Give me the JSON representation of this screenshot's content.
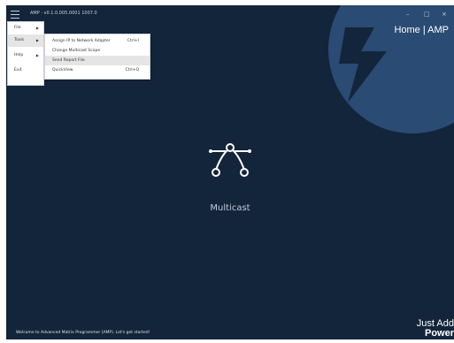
{
  "titlebar": {
    "app_title": "AMP · v0.1.0.005.0001 1007.0",
    "minimize_glyph": "–",
    "maximize_glyph": "□",
    "close_glyph": "×"
  },
  "header": {
    "home_link": "Home | AMP"
  },
  "menu": {
    "items": [
      {
        "label": "File",
        "has_submenu": true
      },
      {
        "label": "Tools",
        "has_submenu": true
      },
      {
        "label": "Help",
        "has_submenu": true
      },
      {
        "label": "Exit",
        "has_submenu": false
      }
    ],
    "active_item": "Tools"
  },
  "tools_submenu": {
    "items": [
      {
        "label": "Assign IP to Network Adapter",
        "shortcut": "Ctrl+I"
      },
      {
        "label": "Change Multicast Scope",
        "shortcut": ""
      },
      {
        "label": "Send Report File",
        "shortcut": ""
      },
      {
        "label": "QuickView",
        "shortcut": "Ctrl+Q"
      }
    ],
    "hovered_item": "Send Report File"
  },
  "main": {
    "icon": "multicast-icon",
    "label": "Multicast"
  },
  "statusbar": {
    "message": "Welcome to Advanced Matrix Programmer (AMP). Let's get started!"
  },
  "brand": {
    "line1": "Just Add",
    "line2": "Power"
  },
  "colors": {
    "background": "#13253b",
    "deco_circle": "#294b74",
    "menu_bg": "#ffffff",
    "text_light": "#c4ccd6"
  }
}
